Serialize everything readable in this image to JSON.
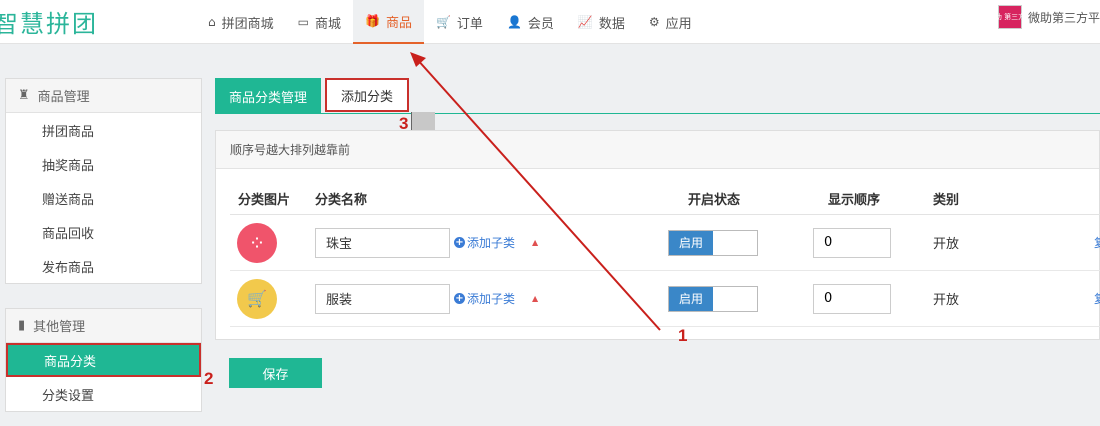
{
  "logo": "智慧拼团",
  "nav": [
    {
      "icon": "⌂",
      "icon_name": "home-icon",
      "label": "拼团商城",
      "active": false
    },
    {
      "icon": "▭",
      "icon_name": "monitor-icon",
      "label": "商城",
      "active": false
    },
    {
      "icon": "🎁",
      "icon_name": "gift-icon",
      "label": "商品",
      "active": true
    },
    {
      "icon": "🛒",
      "icon_name": "cart-icon",
      "label": "订单",
      "active": false
    },
    {
      "icon": "👤",
      "icon_name": "user-icon",
      "label": "会员",
      "active": false
    },
    {
      "icon": "📈",
      "icon_name": "chart-icon",
      "label": "数据",
      "active": false
    },
    {
      "icon": "⚙",
      "icon_name": "apps-icon",
      "label": "应用",
      "active": false
    }
  ],
  "user": {
    "avatar_text": "微助 第三方平",
    "name": "微助第三方平"
  },
  "sidebar": {
    "group1": {
      "title": "商品管理",
      "items": [
        "拼团商品",
        "抽奖商品",
        "赠送商品",
        "商品回收",
        "发布商品"
      ]
    },
    "group2": {
      "title": "其他管理",
      "items": [
        "商品分类",
        "分类设置"
      ]
    }
  },
  "tabs": {
    "manage": "商品分类管理",
    "add": "添加分类"
  },
  "content": {
    "hint": "顺序号越大排列越靠前",
    "headers": {
      "image": "分类图片",
      "name": "分类名称",
      "status": "开启状态",
      "order": "显示顺序",
      "type": "类别"
    },
    "rows": [
      {
        "name": "珠宝",
        "add_sub": "添加子类",
        "status": "启用",
        "order": "0",
        "type": "开放",
        "edge": "复",
        "icon": "⁘",
        "icon_name": "grid-icon",
        "color": "#f0546b"
      },
      {
        "name": "服装",
        "add_sub": "添加子类",
        "status": "启用",
        "order": "0",
        "type": "开放",
        "edge": "复",
        "icon": "🛒",
        "icon_name": "cart-icon",
        "color": "#f2c94c"
      }
    ]
  },
  "save_label": "保存",
  "annotations": {
    "n1": "1",
    "n2": "2",
    "n3": "3"
  },
  "colors": {
    "accent": "#1fb794",
    "active_nav": "#e4622a",
    "annotation": "#c9201c",
    "toggle": "#3a87c8"
  }
}
